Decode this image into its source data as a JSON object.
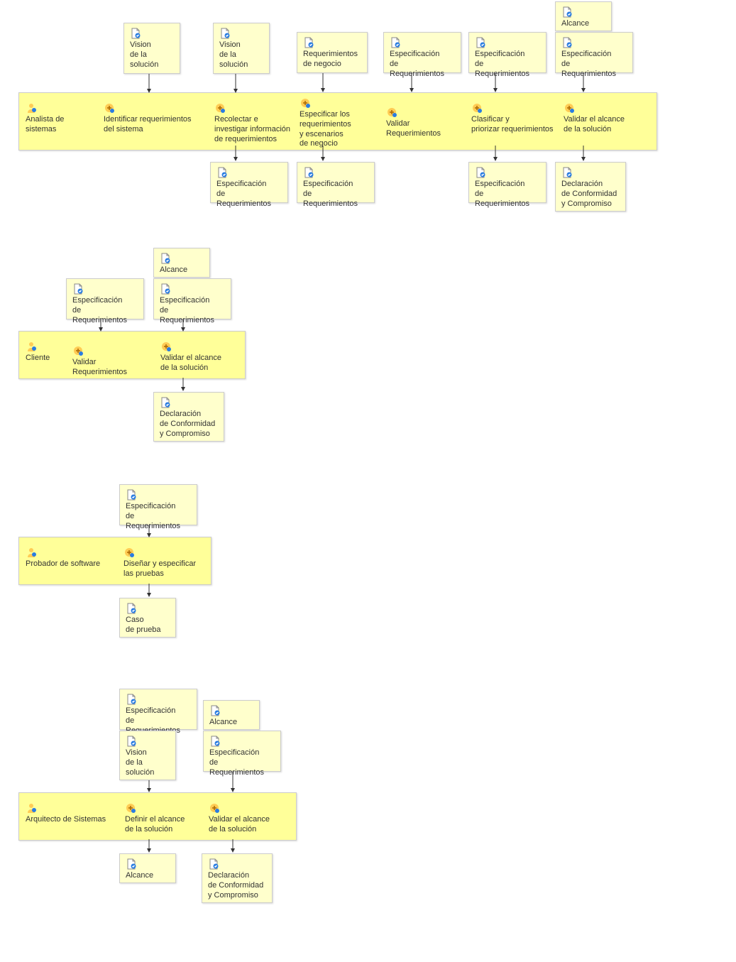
{
  "artifacts": {
    "vision": "Vision\nde la\nsolución",
    "reqNegocio": "Requerimientos\nde negocio",
    "especReq": "Especificación\nde Requerimientos",
    "alcance": "Alcance",
    "declConf": "Declaración\nde Conformidad\ny Compromiso",
    "casoPrueba": "Caso\nde prueba"
  },
  "roles": {
    "analista": "Analista de sistemas",
    "cliente": "Cliente",
    "probador": "Probador de software",
    "arquitecto": "Arquitecto de Sistemas"
  },
  "tasks": {
    "identReq": "Identificar requerimientos\ndel sistema",
    "recolectar": "Recolectar e\ninvestigar información\nde requerimientos",
    "especEsc": "Especificar los\nrequerimientos\ny escenarios\nde negocio",
    "validarReq": "Validar Requerimientos",
    "clasificar": "Clasificar y\npriorizar requerimientos",
    "validarAlc": "Validar el alcance\nde la solución",
    "disenarPruebas": "Diseñar y especificar\nlas pruebas",
    "definirAlc": "Definir el alcance\nde la solución"
  }
}
